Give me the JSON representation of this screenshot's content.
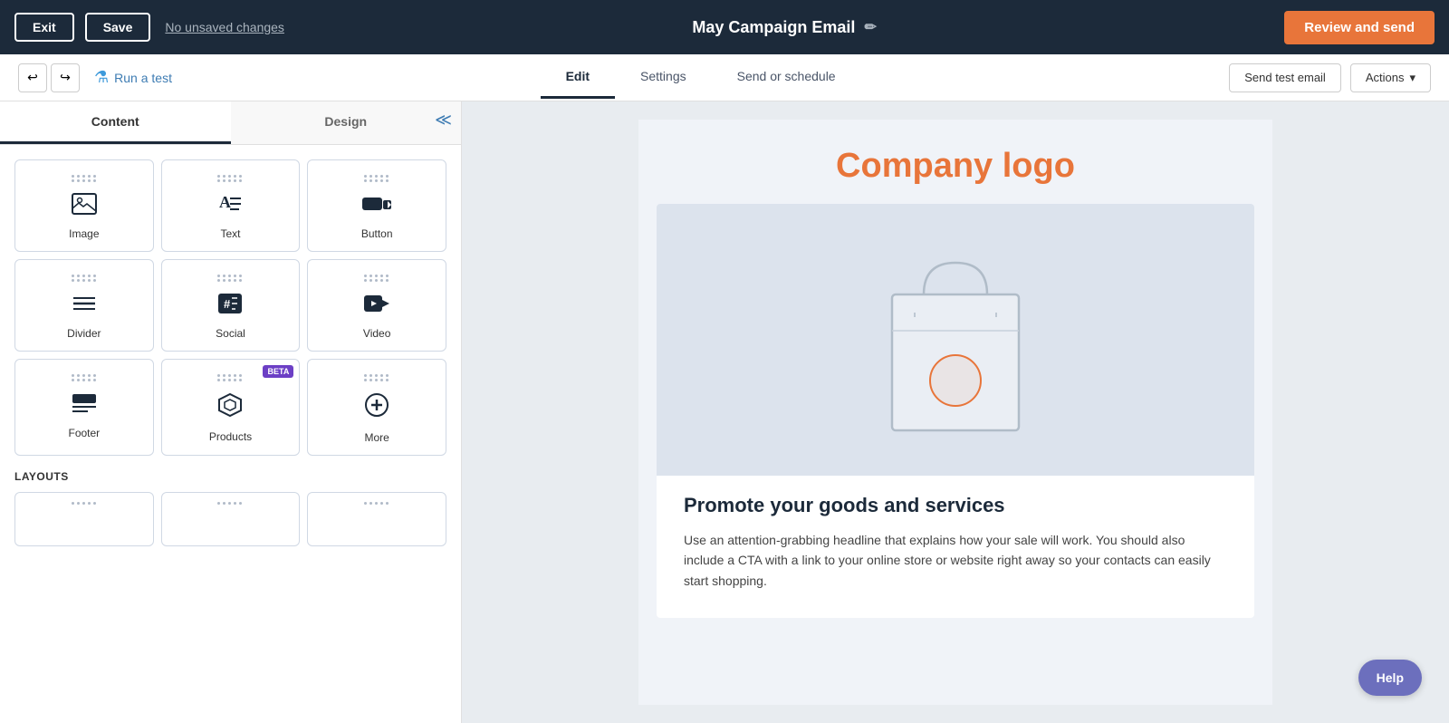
{
  "topBar": {
    "exit_label": "Exit",
    "save_label": "Save",
    "unsaved_label": "No unsaved changes",
    "title": "May Campaign Email",
    "edit_icon": "✏",
    "review_send_label": "Review and send"
  },
  "subBar": {
    "run_test_label": "Run a test",
    "tabs": [
      {
        "id": "edit",
        "label": "Edit",
        "active": true
      },
      {
        "id": "settings",
        "label": "Settings",
        "active": false
      },
      {
        "id": "send_or_schedule",
        "label": "Send or schedule",
        "active": false
      }
    ],
    "send_test_email_label": "Send test email",
    "actions_label": "Actions"
  },
  "sidebar": {
    "content_tab_label": "Content",
    "design_tab_label": "Design",
    "components": [
      {
        "id": "image",
        "label": "Image",
        "icon": "🖼"
      },
      {
        "id": "text",
        "label": "Text",
        "icon": "A≡"
      },
      {
        "id": "button",
        "label": "Button",
        "icon": "▬►"
      },
      {
        "id": "divider",
        "label": "Divider",
        "icon": "≡"
      },
      {
        "id": "social",
        "label": "Social",
        "icon": "#💬"
      },
      {
        "id": "video",
        "label": "Video",
        "icon": "🎬"
      },
      {
        "id": "footer",
        "label": "Footer",
        "icon": "▬≡"
      },
      {
        "id": "products",
        "label": "Products",
        "icon": "⬡",
        "beta": true
      },
      {
        "id": "more",
        "label": "More",
        "icon": "+"
      }
    ],
    "layouts_title": "LAYOUTS"
  },
  "emailPreview": {
    "company_logo_text": "Company logo",
    "card_title": "Promote your goods and services",
    "card_body": "Use an attention-grabbing headline that explains how your sale will work. You should also include a CTA with a link to your online store or website right away so your contacts can easily start shopping."
  },
  "help_label": "Help"
}
